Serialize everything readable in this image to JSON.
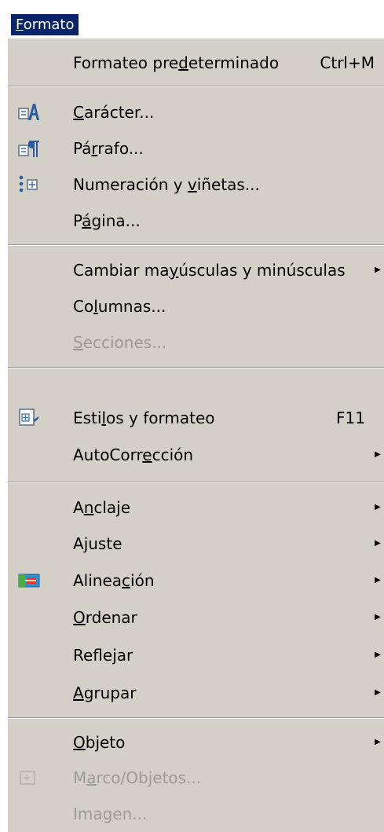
{
  "menubar": {
    "title_mnemonic": "F",
    "title_rest": "ormato"
  },
  "menu": {
    "items": [
      {
        "id": "formateo-predeterminado",
        "pre": "Formateo pre",
        "mn": "d",
        "post": "eterminado",
        "shortcut": "Ctrl+M",
        "submenu": false,
        "disabled": false,
        "icon": ""
      },
      {
        "id": "caracter",
        "pre": "",
        "mn": "C",
        "post": "arácter...",
        "shortcut": "",
        "submenu": false,
        "disabled": false,
        "icon": "character-icon"
      },
      {
        "id": "parrafo",
        "pre": "Pá",
        "mn": "r",
        "post": "rafo...",
        "shortcut": "",
        "submenu": false,
        "disabled": false,
        "icon": "paragraph-icon"
      },
      {
        "id": "numeracion-vinetas",
        "pre": "Numeración y ",
        "mn": "v",
        "post": "iñetas...",
        "shortcut": "",
        "submenu": false,
        "disabled": false,
        "icon": "bullets-numbering-icon"
      },
      {
        "id": "pagina",
        "pre": "P",
        "mn": "á",
        "post": "gina...",
        "shortcut": "",
        "submenu": false,
        "disabled": false,
        "icon": ""
      },
      {
        "id": "cambiar-mayusculas",
        "pre": "Cambiar ma",
        "mn": "y",
        "post": "úsculas y minúsculas",
        "shortcut": "",
        "submenu": true,
        "disabled": false,
        "icon": ""
      },
      {
        "id": "columnas",
        "pre": "Co",
        "mn": "l",
        "post": "umnas...",
        "shortcut": "",
        "submenu": false,
        "disabled": false,
        "icon": ""
      },
      {
        "id": "secciones",
        "pre": "",
        "mn": "S",
        "post": "ecciones...",
        "shortcut": "",
        "submenu": false,
        "disabled": true,
        "icon": ""
      },
      {
        "id": "estilos-formateo",
        "pre": "Esti",
        "mn": "l",
        "post": "os y formateo",
        "shortcut": "F11",
        "submenu": false,
        "disabled": false,
        "icon": "styles-icon"
      },
      {
        "id": "autocorreccion",
        "pre": "AutoCorr",
        "mn": "e",
        "post": "cción",
        "shortcut": "",
        "submenu": true,
        "disabled": false,
        "icon": ""
      },
      {
        "id": "anclaje",
        "pre": "A",
        "mn": "n",
        "post": "claje",
        "shortcut": "",
        "submenu": true,
        "disabled": false,
        "icon": ""
      },
      {
        "id": "ajuste",
        "pre": "A",
        "mn": "j",
        "post": "uste",
        "shortcut": "",
        "submenu": true,
        "disabled": false,
        "icon": ""
      },
      {
        "id": "alineacion",
        "pre": "Alinea",
        "mn": "c",
        "post": "ión",
        "shortcut": "",
        "submenu": true,
        "disabled": false,
        "icon": "alignment-icon"
      },
      {
        "id": "ordenar",
        "pre": "",
        "mn": "O",
        "post": "rdenar",
        "shortcut": "",
        "submenu": true,
        "disabled": false,
        "icon": ""
      },
      {
        "id": "reflejar",
        "pre": "Refle",
        "mn": "j",
        "post": "ar",
        "shortcut": "",
        "submenu": true,
        "disabled": false,
        "icon": ""
      },
      {
        "id": "agrupar",
        "pre": "",
        "mn": "A",
        "post": "grupar",
        "shortcut": "",
        "submenu": true,
        "disabled": false,
        "icon": ""
      },
      {
        "id": "objeto",
        "pre": "",
        "mn": "O",
        "post": "bjeto",
        "shortcut": "",
        "submenu": true,
        "disabled": false,
        "icon": ""
      },
      {
        "id": "marco-objetos",
        "pre": "M",
        "mn": "a",
        "post": "rco/Objetos...",
        "shortcut": "",
        "submenu": false,
        "disabled": true,
        "icon": "frame-icon"
      },
      {
        "id": "imagen",
        "pre": "Ima",
        "mn": "g",
        "post": "en...",
        "shortcut": "",
        "submenu": false,
        "disabled": true,
        "icon": ""
      }
    ]
  },
  "colors": {
    "menu_background": "#d4d0c8",
    "highlight": "#0a246a",
    "disabled_text": "#9e9a94"
  }
}
